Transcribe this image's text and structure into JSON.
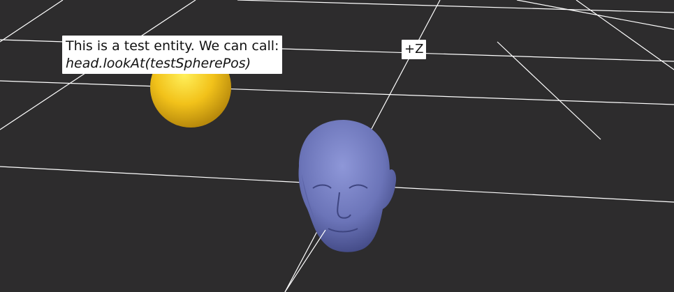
{
  "scene": {
    "background_color": "#2d2c2d",
    "grid_color": "#ffffff",
    "sphere_color": "#f2c21a",
    "head_color": "#6b74b8"
  },
  "entity_tooltip": {
    "line1": "This is a test entity. We can call:",
    "line2": "head.lookAt(testSpherePos)"
  },
  "axis_label": "+Z"
}
